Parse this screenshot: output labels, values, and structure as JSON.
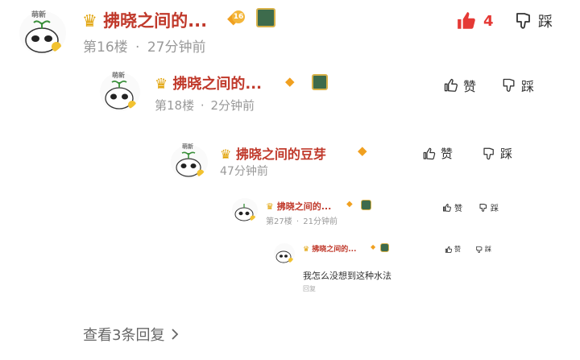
{
  "comment": {
    "avatar_tag": "萌新",
    "username": "拂晓之间的...",
    "level_badge": "16",
    "floor": "第16楼",
    "separator": "·",
    "time": "27分钟前",
    "like_count": "4",
    "dislike_label": "踩",
    "liked_color": "#e53935"
  },
  "screenshot": {
    "c1": {
      "avatar_tag": "萌新",
      "username": "拂晓之间的...",
      "floor": "第18楼",
      "separator": "·",
      "time": "2分钟前",
      "like_label": "赞",
      "dislike_label": "踩"
    },
    "c2": {
      "avatar_tag": "萌新",
      "username": "拂晓之间的豆芽",
      "time": "47分钟前",
      "like_label": "赞",
      "dislike_label": "踩"
    },
    "c3": {
      "username": "拂晓之间的...",
      "floor": "第27楼",
      "separator": "·",
      "time": "21分钟前",
      "like_label": "赞",
      "dislike_label": "踩"
    },
    "c4": {
      "username": "拂晓之间的...",
      "like_label": "赞",
      "dislike_label": "踩",
      "text": "我怎么没想到这种水法",
      "reply_label": "回复"
    }
  },
  "view_replies": "查看3条回复",
  "icons": {
    "crown": "crown-icon",
    "diamond": "diamond-icon",
    "medal": "medal-icon",
    "thumb_up": "thumb-up-icon",
    "thumb_down": "thumb-down-icon",
    "chevron": "chevron-right-icon"
  }
}
